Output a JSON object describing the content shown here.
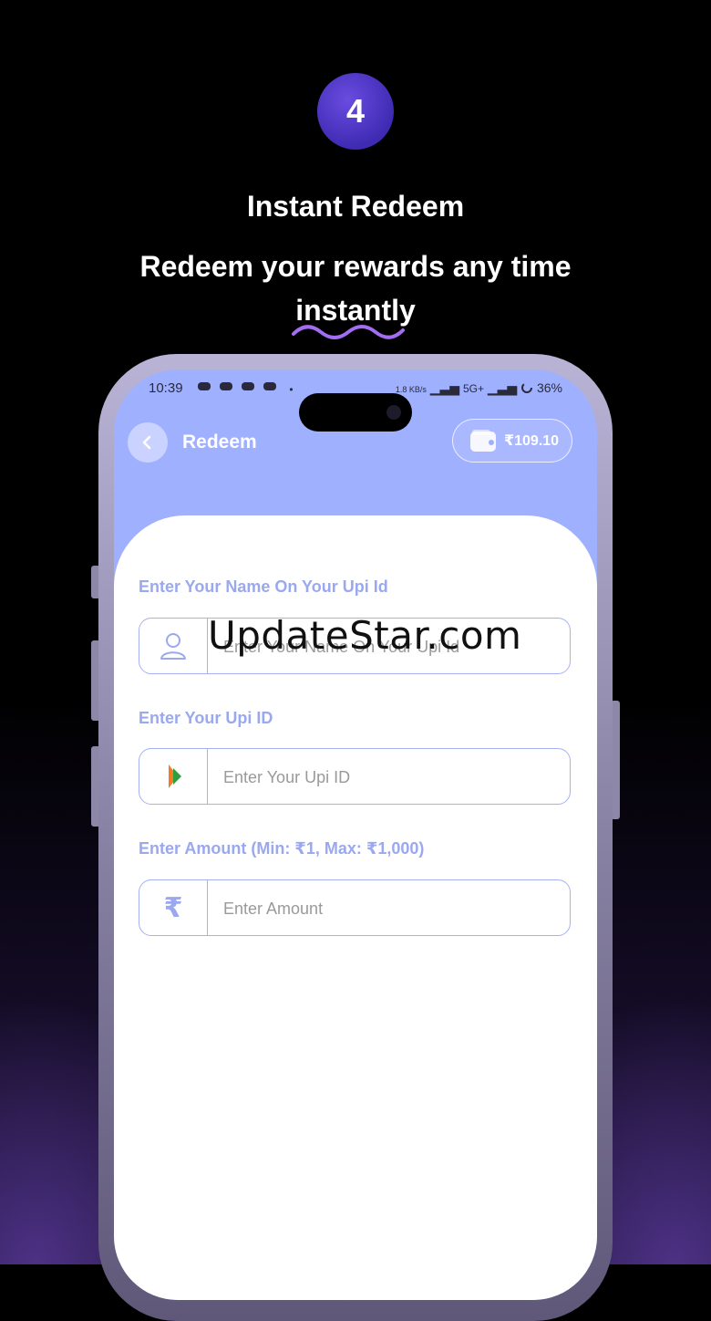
{
  "step": {
    "number": "4"
  },
  "headline": {
    "title": "Instant Redeem",
    "subtitle_line1": "Redeem your rewards any time",
    "subtitle_line2": "instantly"
  },
  "status_bar": {
    "time": "10:39",
    "network_speed": "1.8 KB/s",
    "network_label": "5G+",
    "battery": "36%"
  },
  "header": {
    "title": "Redeem",
    "wallet_balance": "₹109.10"
  },
  "form": {
    "name_label": "Enter Your Name On Your Upi Id",
    "name_placeholder": "Enter Your Name On Your Upi Id",
    "upi_label": "Enter Your Upi ID",
    "upi_placeholder": "Enter Your Upi ID",
    "amount_label": "Enter Amount (Min: ₹1, Max: ₹1,000)",
    "amount_placeholder": "Enter Amount",
    "currency_symbol": "₹"
  },
  "watermark": "UpdateStar.com",
  "colors": {
    "accent": "#9fb0ff",
    "label": "#9aa8f0",
    "step_circle": "#4a34c4"
  }
}
